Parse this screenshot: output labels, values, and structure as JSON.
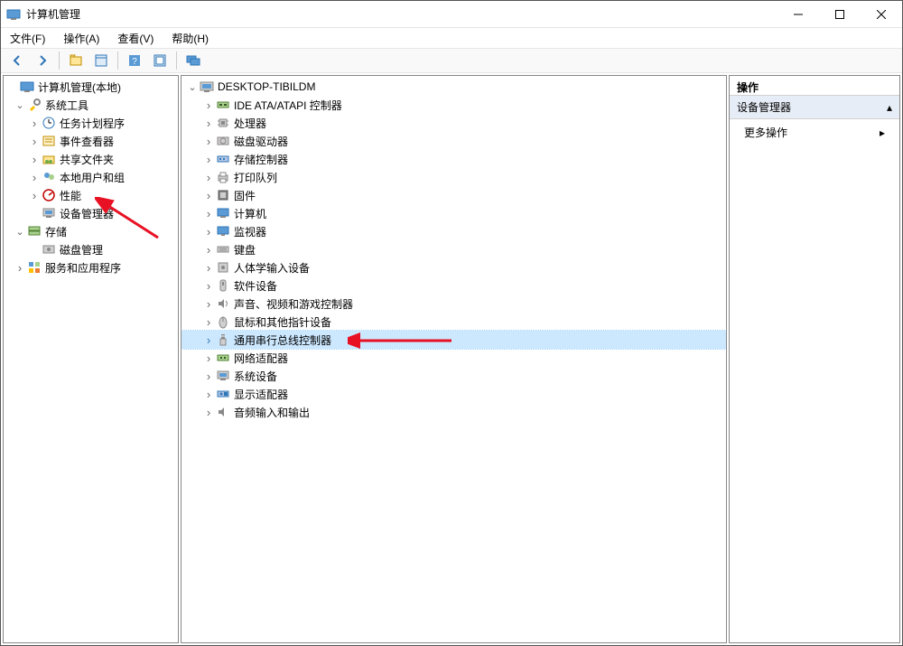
{
  "window": {
    "title": "计算机管理"
  },
  "menu": {
    "file": "文件(F)",
    "action": "操作(A)",
    "view": "查看(V)",
    "help": "帮助(H)"
  },
  "left_tree": {
    "root": "计算机管理(本地)",
    "system_tools": "系统工具",
    "task_scheduler": "任务计划程序",
    "event_viewer": "事件查看器",
    "shared_folders": "共享文件夹",
    "local_users": "本地用户和组",
    "performance": "性能",
    "device_manager": "设备管理器",
    "storage": "存储",
    "disk_mgmt": "磁盘管理",
    "services": "服务和应用程序"
  },
  "center_tree": {
    "root": "DESKTOP-TIBILDM",
    "ide": "IDE ATA/ATAPI 控制器",
    "cpu": "处理器",
    "diskdrive": "磁盘驱动器",
    "storage_ctrl": "存储控制器",
    "print_queue": "打印队列",
    "firmware": "固件",
    "computer": "计算机",
    "monitor": "监视器",
    "keyboard": "键盘",
    "hid": "人体学输入设备",
    "software_dev": "软件设备",
    "sound": "声音、视频和游戏控制器",
    "mouse": "鼠标和其他指针设备",
    "usb": "通用串行总线控制器",
    "network": "网络适配器",
    "system_dev": "系统设备",
    "display": "显示适配器",
    "audio_io": "音频输入和输出"
  },
  "right_panel": {
    "header": "操作",
    "section": "设备管理器",
    "more": "更多操作"
  }
}
